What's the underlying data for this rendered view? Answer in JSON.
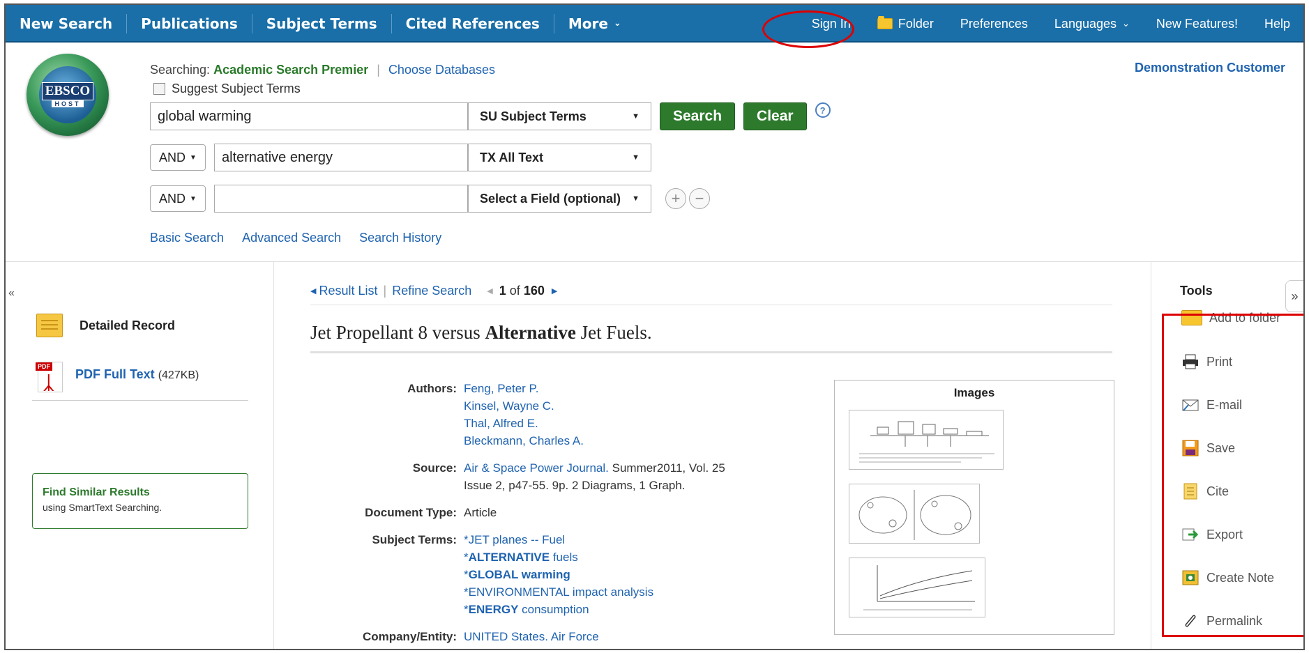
{
  "nav": {
    "left": [
      "New Search",
      "Publications",
      "Subject Terms",
      "Cited References",
      "More"
    ],
    "more_chevron": "⌄",
    "right": {
      "sign_in": "Sign In",
      "folder": "Folder",
      "preferences": "Preferences",
      "languages": "Languages",
      "new_features": "New Features!",
      "help": "Help"
    }
  },
  "logo": {
    "line1": "EBSCO",
    "line2": "HOST"
  },
  "search": {
    "searching_label": "Searching:",
    "database": "Academic Search Premier",
    "choose_databases": "Choose Databases",
    "suggest_label": "Suggest Subject Terms",
    "rows": [
      {
        "bool": "",
        "term": "global warming",
        "field": "SU Subject Terms"
      },
      {
        "bool": "AND",
        "term": "alternative energy",
        "field": "TX All Text"
      },
      {
        "bool": "AND",
        "term": "",
        "field": "Select a Field (optional)"
      }
    ],
    "search_button": "Search",
    "clear_button": "Clear",
    "help_glyph": "?",
    "links": [
      "Basic Search",
      "Advanced Search",
      "Search History"
    ]
  },
  "account": "Demonstration Customer",
  "left_panel": {
    "detailed_record": "Detailed Record",
    "pdf_label": "PDF Full Text",
    "pdf_size": "(427KB)",
    "pdf_tag": "PDF",
    "find_similar_title": "Find Similar Results",
    "find_similar_sub": "using SmartText Searching."
  },
  "record_nav": {
    "result_list": "Result List",
    "refine_search": "Refine Search",
    "position": "1",
    "of": "of",
    "total": "160"
  },
  "record": {
    "title_pre": "Jet Propellant 8 versus ",
    "title_bold": "Alternative",
    "title_post": " Jet Fuels.",
    "authors_label": "Authors:",
    "authors": [
      "Feng, Peter P.",
      "Kinsel, Wayne C.",
      "Thal, Alfred E.",
      "Bleckmann, Charles A."
    ],
    "source_label": "Source:",
    "source_journal": "Air & Space Power Journal.",
    "source_detail1": " Summer2011, Vol. 25",
    "source_detail2": "Issue 2, p47-55. 9p. 2 Diagrams, 1 Graph.",
    "doctype_label": "Document Type:",
    "doctype": "Article",
    "subjects_label": "Subject Terms:",
    "subjects": [
      {
        "bold": "",
        "text": "*JET planes -- Fuel"
      },
      {
        "bold": "ALTERNATIVE",
        "text": " fuels"
      },
      {
        "bold": "GLOBAL warming",
        "text": ""
      },
      {
        "bold": "",
        "text": "*ENVIRONMENTAL impact analysis"
      },
      {
        "bold": "ENERGY",
        "text": " consumption"
      }
    ],
    "company_label": "Company/Entity:",
    "company": "UNITED States. Air Force"
  },
  "images_panel": {
    "title": "Images"
  },
  "tools": {
    "title": "Tools",
    "add_to_folder": "Add to folder",
    "items": [
      "Print",
      "E-mail",
      "Save",
      "Cite",
      "Export",
      "Create Note",
      "Permalink"
    ]
  },
  "colors": {
    "nav_bg": "#1a6fa8",
    "green": "#2d7a2d",
    "link": "#1f63b0",
    "highlight": "#dd0000"
  }
}
